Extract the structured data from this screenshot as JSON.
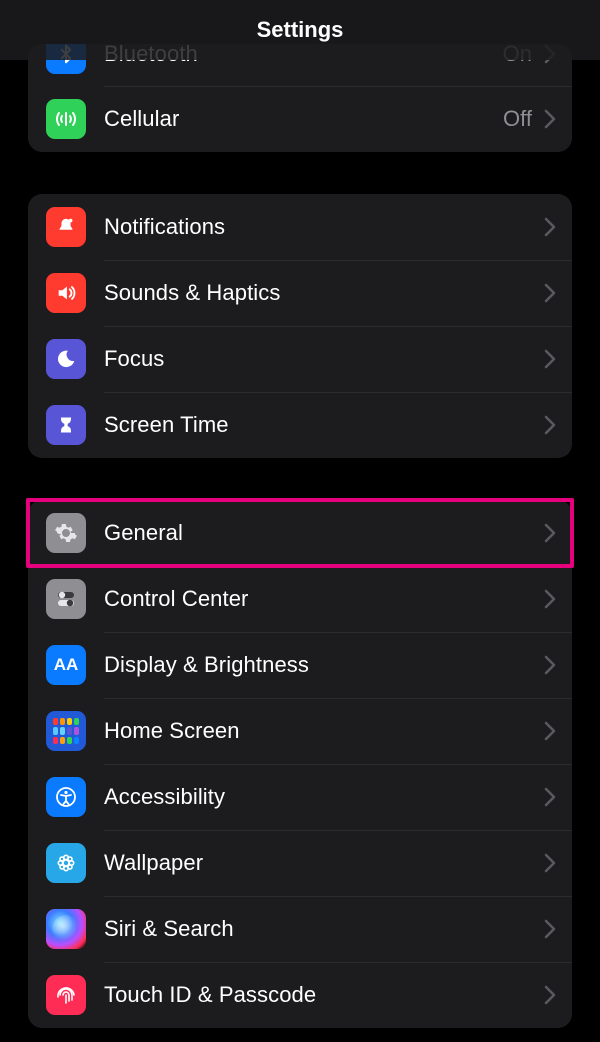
{
  "nav": {
    "title": "Settings"
  },
  "g1": {
    "bluetooth": {
      "label": "Bluetooth",
      "value": "On"
    },
    "cellular": {
      "label": "Cellular",
      "value": "Off"
    }
  },
  "g2": {
    "notifications": {
      "label": "Notifications"
    },
    "sounds": {
      "label": "Sounds & Haptics"
    },
    "focus": {
      "label": "Focus"
    },
    "screentime": {
      "label": "Screen Time"
    }
  },
  "g3": {
    "general": {
      "label": "General"
    },
    "control": {
      "label": "Control Center"
    },
    "display": {
      "label": "Display & Brightness",
      "icon_text": "AA"
    },
    "homescreen": {
      "label": "Home Screen"
    },
    "accessibility": {
      "label": "Accessibility"
    },
    "wallpaper": {
      "label": "Wallpaper"
    },
    "siri": {
      "label": "Siri & Search"
    },
    "touchid": {
      "label": "Touch ID & Passcode"
    }
  },
  "highlight": {
    "target": "general"
  }
}
